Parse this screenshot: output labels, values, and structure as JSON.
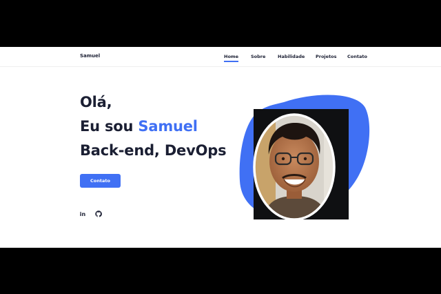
{
  "brand": {
    "name": "Samuel"
  },
  "nav": {
    "items": [
      {
        "label": "Home",
        "active": true
      },
      {
        "label": "Sobre",
        "active": false
      },
      {
        "label": "Habilidade",
        "active": false
      },
      {
        "label": "Projetos",
        "active": false
      },
      {
        "label": "Contato",
        "active": false
      }
    ]
  },
  "hero": {
    "greeting": "Olá,",
    "intro_prefix": "Eu sou",
    "intro_name": "Samuel",
    "role": "Back-end, DevOps",
    "cta_label": "Contato"
  },
  "social": {
    "linkedin_label": "in",
    "icons": [
      "linkedin-icon",
      "github-icon"
    ]
  },
  "colors": {
    "accent": "#4070f4",
    "text_dark": "#1b1f33",
    "background": "#ffffff",
    "letterbox": "#000000"
  }
}
